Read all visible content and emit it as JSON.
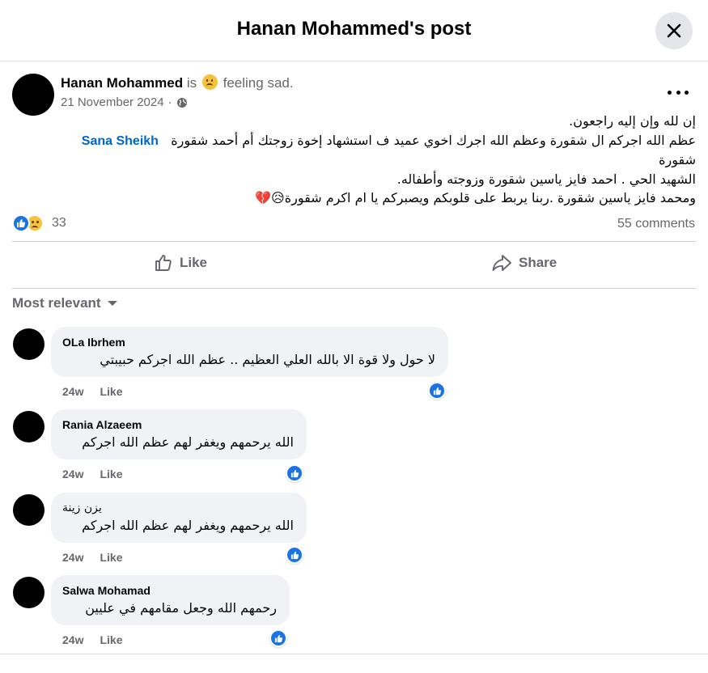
{
  "header": {
    "title": "Hanan Mohammed's post"
  },
  "post": {
    "author": "Hanan Mohammed",
    "is_text": "is",
    "feeling": "feeling sad.",
    "date": "21 November 2024",
    "separator": "·",
    "audience_icon": "globe-icon",
    "body_lines": [
      "إن لله وإن إليه راجعون.",
      "عظم الله اجركم ال شقورة  وعظم الله اجرك اخوي  عميد ف استشهاد  إخوة زوجتك أم أحمد شقورة",
      "شقورة",
      "الشهيد الحي . احمد فايز ياسين شقورة  وزوجته وأطفاله.",
      "ومحمد فايز ياسين شقورة .ربنا يربط على قلوبكم ويصبركم يا ام اكرم شقورة😥💔"
    ],
    "mention": "Sana Sheikh",
    "reaction_count": "33",
    "comments_count": "55 comments"
  },
  "actions": {
    "like_label": "Like",
    "share_label": "Share"
  },
  "sort": {
    "label": "Most relevant"
  },
  "comments": [
    {
      "name": "OLa Ibrhem",
      "text": "لا حول ولا قوة الا بالله العلي العظيم .. عظم الله اجركم حبيبتي",
      "time": "24w",
      "like_label": "Like"
    },
    {
      "name": "Rania Alzaeem",
      "text": "الله يرحمهم ويغفر لهم عظم الله اجركم",
      "time": "24w",
      "like_label": "Like"
    },
    {
      "name": "يزن زينة",
      "text": "الله يرحمهم ويغفر لهم عظم الله اجركم",
      "time": "24w",
      "like_label": "Like"
    },
    {
      "name": "Salwa Mohamad",
      "text": "رحمهم الله وجعل مقامهم في عليين",
      "time": "24w",
      "like_label": "Like"
    }
  ],
  "colors": {
    "brand_blue": "#1b74e4",
    "mention_blue": "#0064d1",
    "secondary_text": "#65676b",
    "bubble_bg": "#f0f2f5",
    "close_bg": "#e4e6eb"
  }
}
